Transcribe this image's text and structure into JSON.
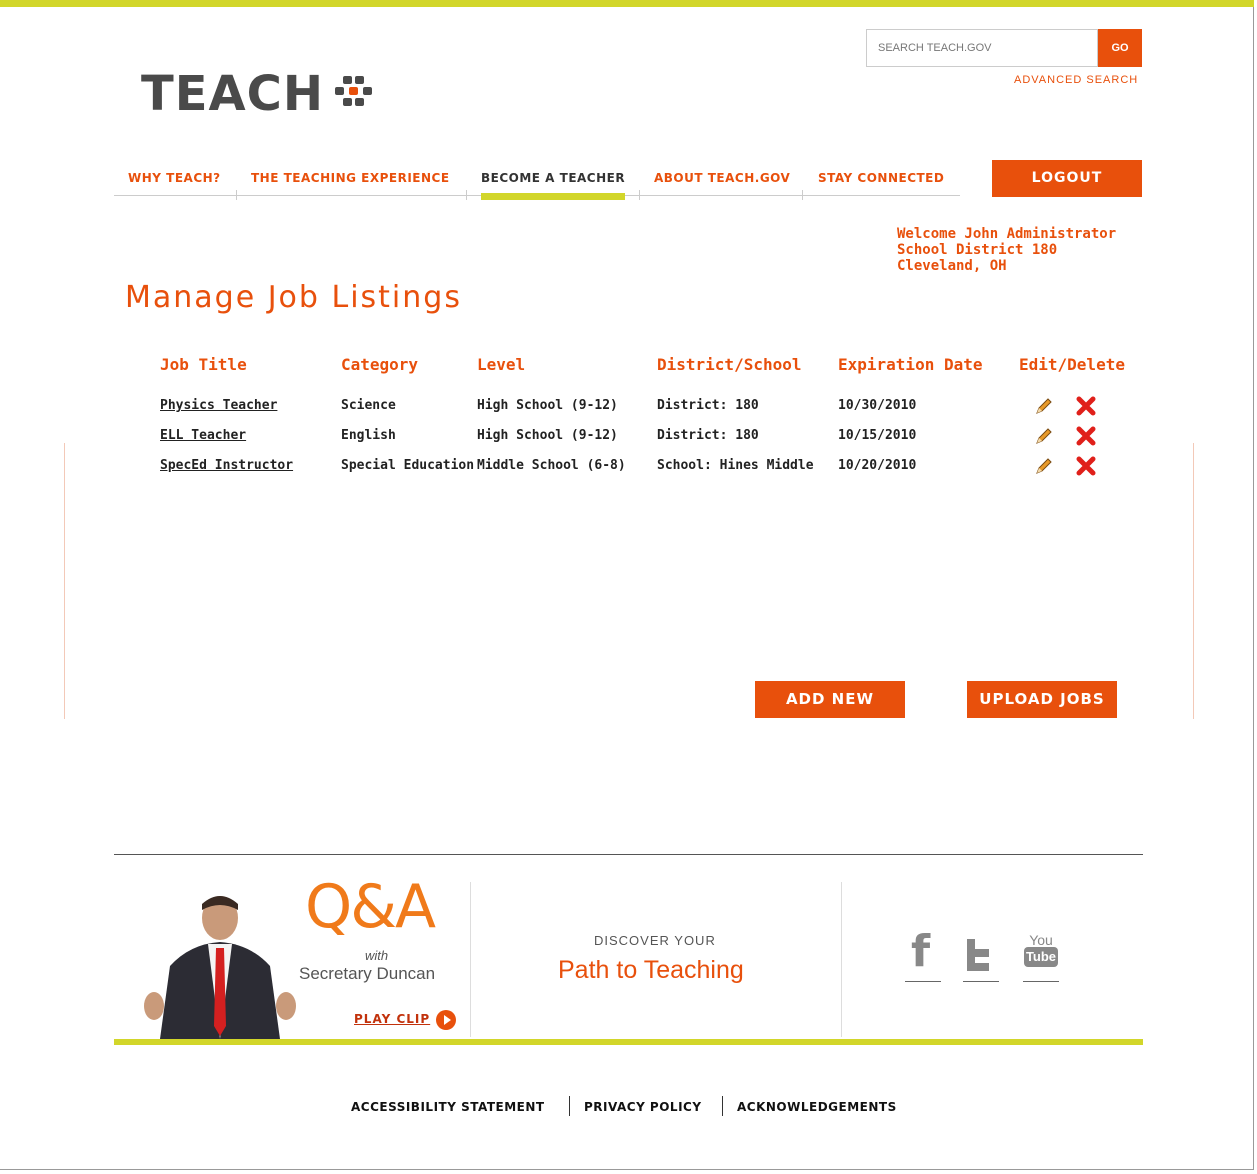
{
  "header": {
    "logo_text": "TEACH",
    "search": {
      "placeholder": "SEARCH TEACH.GOV",
      "go_label": "GO"
    },
    "advanced_search": "ADVANCED SEARCH"
  },
  "nav": {
    "items": [
      {
        "label": "WHY TEACH?"
      },
      {
        "label": "THE TEACHING EXPERIENCE"
      },
      {
        "label": "BECOME A TEACHER",
        "active": true
      },
      {
        "label": "ABOUT TEACH.GOV"
      },
      {
        "label": "STAY CONNECTED"
      }
    ],
    "logout_label": "LOGOUT"
  },
  "welcome": {
    "line1": "Welcome John Administrator",
    "line2": "School District 180",
    "line3": "Cleveland, OH"
  },
  "page_title": "Manage Job Listings",
  "table": {
    "headers": [
      "Job Title",
      "Category",
      "Level",
      "District/School",
      "Expiration Date",
      "Edit/Delete"
    ],
    "rows": [
      [
        "Physics Teacher",
        "Science",
        "High School (9-12)",
        "District: 180",
        "10/30/2010"
      ],
      [
        "ELL Teacher",
        "English",
        "High School (9-12)",
        "District: 180",
        "10/15/2010"
      ],
      [
        "SpecEd Instructor",
        "Special Education",
        "Middle School (6-8)",
        "School:  Hines Middle",
        "10/20/2010"
      ]
    ]
  },
  "actions": {
    "add_new": "ADD NEW",
    "upload_jobs": "UPLOAD JOBS"
  },
  "footer": {
    "qa": {
      "title": "Q&A",
      "with": "with",
      "name": "Secretary Duncan",
      "play_clip": "PLAY CLIP"
    },
    "discover": {
      "small": "DISCOVER YOUR",
      "big": "Path to Teaching"
    },
    "social": {
      "facebook": "f",
      "youtube_top": "You",
      "youtube_bottom": "Tube"
    },
    "links": [
      "ACCESSIBILITY STATEMENT",
      "PRIVACY POLICY",
      "ACKNOWLEDGEMENTS"
    ]
  },
  "colors": {
    "accent": "#e8500c",
    "lime": "#d2d62a",
    "dark": "#4a4a4a"
  }
}
